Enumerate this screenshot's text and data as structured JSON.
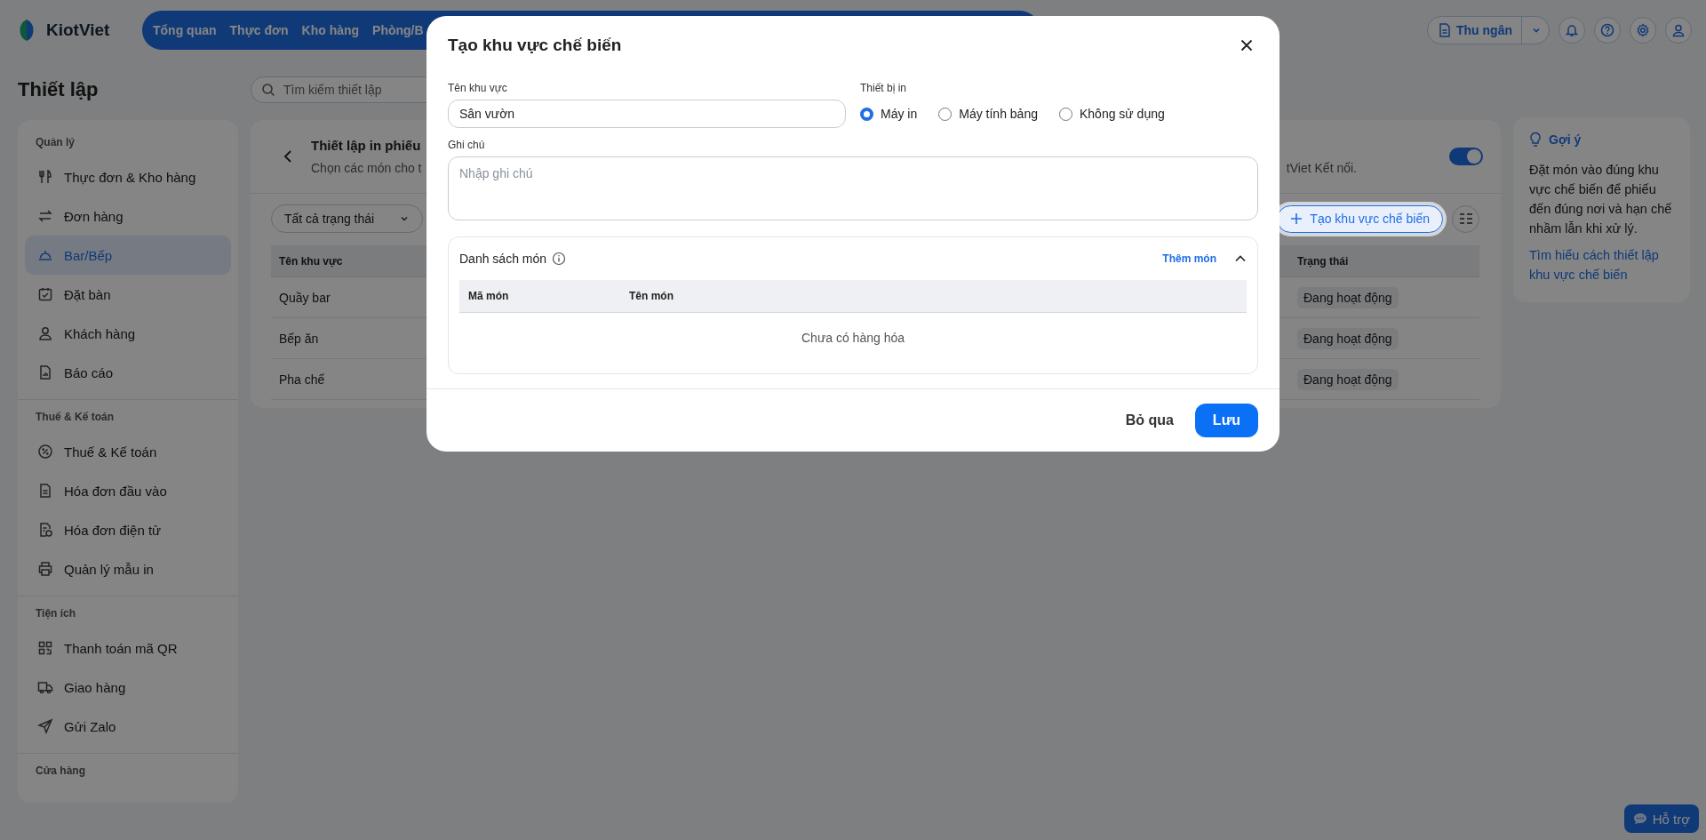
{
  "topbar": {
    "logo": "KiotViet",
    "nav": [
      "Tổng quan",
      "Thực đơn",
      "Kho hàng",
      "Phòng/B"
    ],
    "cashier_button": "Thu ngân"
  },
  "page_title": "Thiết lập",
  "search": {
    "placeholder": "Tìm kiếm thiết lập"
  },
  "sidebar": {
    "sections": [
      {
        "title": "Quản lý",
        "items": [
          {
            "label": "Thực đơn & Kho hàng",
            "selected": false
          },
          {
            "label": "Đơn hàng",
            "selected": false
          },
          {
            "label": "Bar/Bếp",
            "selected": true
          },
          {
            "label": "Đặt bàn",
            "selected": false
          },
          {
            "label": "Khách hàng",
            "selected": false
          },
          {
            "label": "Báo cáo",
            "selected": false
          }
        ]
      },
      {
        "title": "Thuế & Kế toán",
        "items": [
          {
            "label": "Thuế & Kế toán",
            "selected": false
          },
          {
            "label": "Hóa đơn đầu vào",
            "selected": false
          },
          {
            "label": "Hóa đơn điện tử",
            "selected": false
          },
          {
            "label": "Quản lý mẫu in",
            "selected": false
          }
        ]
      },
      {
        "title": "Tiện ích",
        "items": [
          {
            "label": "Thanh toán mã QR",
            "selected": false
          },
          {
            "label": "Giao hàng",
            "selected": false
          },
          {
            "label": "Gửi Zalo",
            "selected": false
          }
        ]
      },
      {
        "title": "Cửa hàng"
      }
    ]
  },
  "main": {
    "title": "Thiết lập in phiếu",
    "subtitle_left": "Chọn các món cho t",
    "subtitle_right": "tViet Kết nối.",
    "toggle": {
      "on": true
    },
    "filter": "Tất cả trạng thái",
    "create_button": "Tạo khu vực chế biến",
    "table": {
      "columns": [
        "Tên khu vực",
        "Trạng thái"
      ],
      "rows": [
        {
          "name": "Quầy bar",
          "status": "Đang hoạt động"
        },
        {
          "name": "Bếp ăn",
          "status": "Đang hoạt động"
        },
        {
          "name": "Pha chế",
          "status": "Đang hoạt động"
        }
      ]
    }
  },
  "hint": {
    "title": "Gợi ý",
    "text": "Đặt món vào đúng khu vực chế biến để phiếu đến đúng nơi và hạn chế nhầm lẫn khi xử lý.",
    "link": "Tìm hiểu cách thiết lập khu vực chế biến"
  },
  "modal": {
    "title": "Tạo khu vực chế biến",
    "name_field": {
      "label": "Tên khu vực",
      "value": "Sân vườn"
    },
    "device": {
      "label": "Thiết bị in",
      "options": [
        {
          "label": "Máy in",
          "selected": true
        },
        {
          "label": "Máy tính bảng",
          "selected": false
        },
        {
          "label": "Không sử dụng",
          "selected": false
        }
      ]
    },
    "note_field": {
      "label": "Ghi chú",
      "placeholder": "Nhập ghi chú"
    },
    "items": {
      "title": "Danh sách món",
      "add_link": "Thêm món",
      "expanded": true,
      "columns": [
        "Mã món",
        "Tên món"
      ],
      "empty_text": "Chưa có hàng hóa"
    },
    "buttons": {
      "cancel": "Bỏ qua",
      "save": "Lưu"
    }
  },
  "support_button": "Hỗ trợ"
}
